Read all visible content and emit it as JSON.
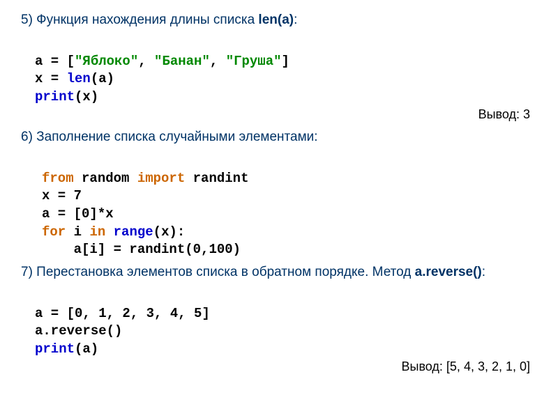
{
  "sections": {
    "s5": {
      "heading_prefix": "5) Функция нахождения длины списка ",
      "heading_func": "len(a)",
      "heading_suffix": ":"
    },
    "s6": {
      "heading": "6) Заполнение списка случайными элементами:"
    },
    "s7": {
      "heading_prefix": "7) Перестановка элементов списка в обратном порядке. Метод ",
      "heading_func": "a.reverse()",
      "heading_suffix": ":"
    }
  },
  "code5": {
    "l1_a": "a = [",
    "l1_s1": "\"Яблоко\"",
    "l1_c1": ", ",
    "l1_s2": "\"Банан\"",
    "l1_c2": ", ",
    "l1_s3": "\"Груша\"",
    "l1_b": "]",
    "l2_a": "x = ",
    "l2_len": "len",
    "l2_b": "(a)",
    "l3_print": "print",
    "l3_a": "(x)",
    "output": "Вывод: 3"
  },
  "code6": {
    "l1_from": "from",
    "l1_mod": " random ",
    "l1_import": "import",
    "l1_name": " randint",
    "l2": "x = 7",
    "l3": "a = [0]*x",
    "l4_for": "for",
    "l4_mid": " i ",
    "l4_in": "in",
    "l4_sp": " ",
    "l4_range": "range",
    "l4_end": "(x):",
    "l5": "    a[i] = randint(0,100)"
  },
  "code7": {
    "l1": "a = [0, 1, 2, 3, 4, 5]",
    "l2": "a.reverse()",
    "l3_print": "print",
    "l3_a": "(a)",
    "output": "Вывод: [5, 4, 3, 2, 1, 0]"
  }
}
